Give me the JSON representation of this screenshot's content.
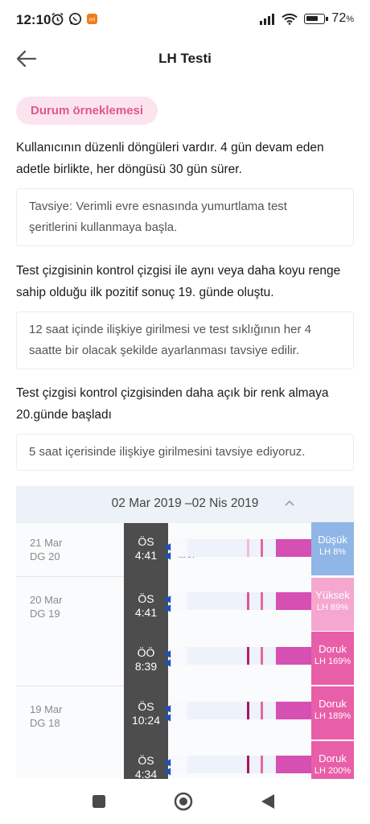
{
  "status": {
    "time": "12:10",
    "battery": "72"
  },
  "header": {
    "title": "LH Testi"
  },
  "tag": "Durum örneklemesi",
  "paragraphs": {
    "p1": [
      "Kullanıcının düzenli döngüleri vardır. 4 gün devam eden",
      "adetle birlikte, her döngüsü 30 gün sürer."
    ],
    "p2": [
      "Test çizgisinin kontrol çizgisi ile aynı veya daha koyu renge",
      "sahip olduğu ilk pozitif sonuç 19. günde oluştu."
    ],
    "p3": [
      "Test çizgisi kontrol çizgisinden daha açık bir renk almaya",
      "20.günde başladı"
    ]
  },
  "tips": {
    "t1": [
      "Tavsiye: Verimli evre esnasında yumurtlama test",
      "şeritlerini kullanmaya başla."
    ],
    "t2": [
      "12 saat içinde ilişkiye girilmesi ve test sıklığının her 4",
      "saatte bir olacak şekilde ayarlanması tavsiye edilir."
    ],
    "t3": [
      "5 saat içerisinde ilişkiye girilmesini tavsiye ediyoruz."
    ]
  },
  "panel": {
    "range": "02 Mar 2019 –02 Nis 2019",
    "days": [
      {
        "date": "21 Mar",
        "cycle": "DG 20"
      },
      {
        "date": "20 Mar",
        "cycle": "DG 19"
      },
      {
        "date": "19 Mar",
        "cycle": "DG 18"
      }
    ],
    "max_label": "MAX",
    "tests": [
      {
        "period": "ÖS",
        "time": "4:41",
        "level": "Düşük",
        "lh": "LH 8%",
        "color": "#8fb6e6"
      },
      {
        "period": "ÖS",
        "time": "4:41",
        "level": "Yüksek",
        "lh": "LH 89%",
        "color": "#f5a7cf"
      },
      {
        "period": "ÖÖ",
        "time": "8:39",
        "level": "Doruk",
        "lh": "LH 169%",
        "color": "#e95ea8"
      },
      {
        "period": "ÖS",
        "time": "10:24",
        "level": "Doruk",
        "lh": "LH 189%",
        "color": "#e95ea8"
      },
      {
        "period": "ÖS",
        "time": "4:34",
        "level": "Doruk",
        "lh": "LH 200%",
        "color": "#e95ea8"
      }
    ]
  },
  "colors": {
    "accent": "#e0578d",
    "tag_bg": "#fce4ef",
    "result_band": "#d64fb3",
    "max_text": "#2f5fc9"
  }
}
